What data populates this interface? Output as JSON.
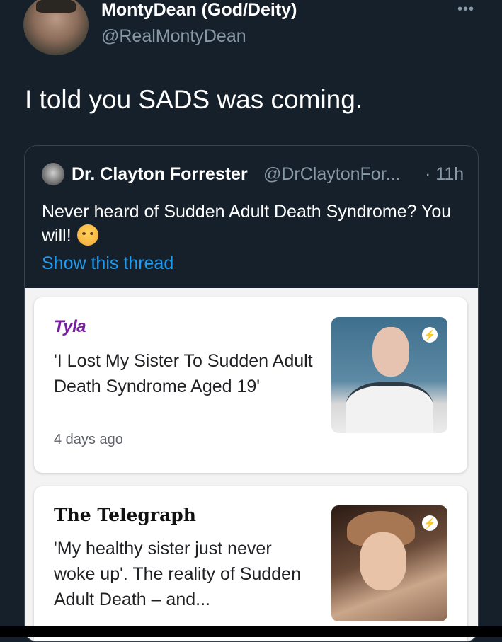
{
  "tweet": {
    "author_name": "MontyDean (God/Deity)",
    "author_handle": "@RealMontyDean",
    "more_icon": "more-icon",
    "text": "I told you SADS was coming."
  },
  "quoted_tweet": {
    "author_name": "Dr. Clayton Forrester",
    "author_handle": "@DrClaytonFor...",
    "time": "· 11h",
    "text": "Never heard of Sudden Adult Death Syndrome? You will!",
    "emoji": "angry-face-emoji",
    "show_thread": "Show this thread"
  },
  "articles": [
    {
      "source": "Tyla",
      "title": "'I Lost My Sister To Sudden Adult Death Syndrome Aged 19'",
      "date": "4 days ago",
      "amp_icon": "amp-bolt-icon"
    },
    {
      "source": "The Telegraph",
      "title": "'My healthy sister just never woke up'. The reality of Sudden Adult Death – and...",
      "amp_icon": "amp-bolt-icon"
    }
  ],
  "colors": {
    "background": "#15202b",
    "link": "#1d9bf0",
    "secondary_text": "#8899a6"
  }
}
